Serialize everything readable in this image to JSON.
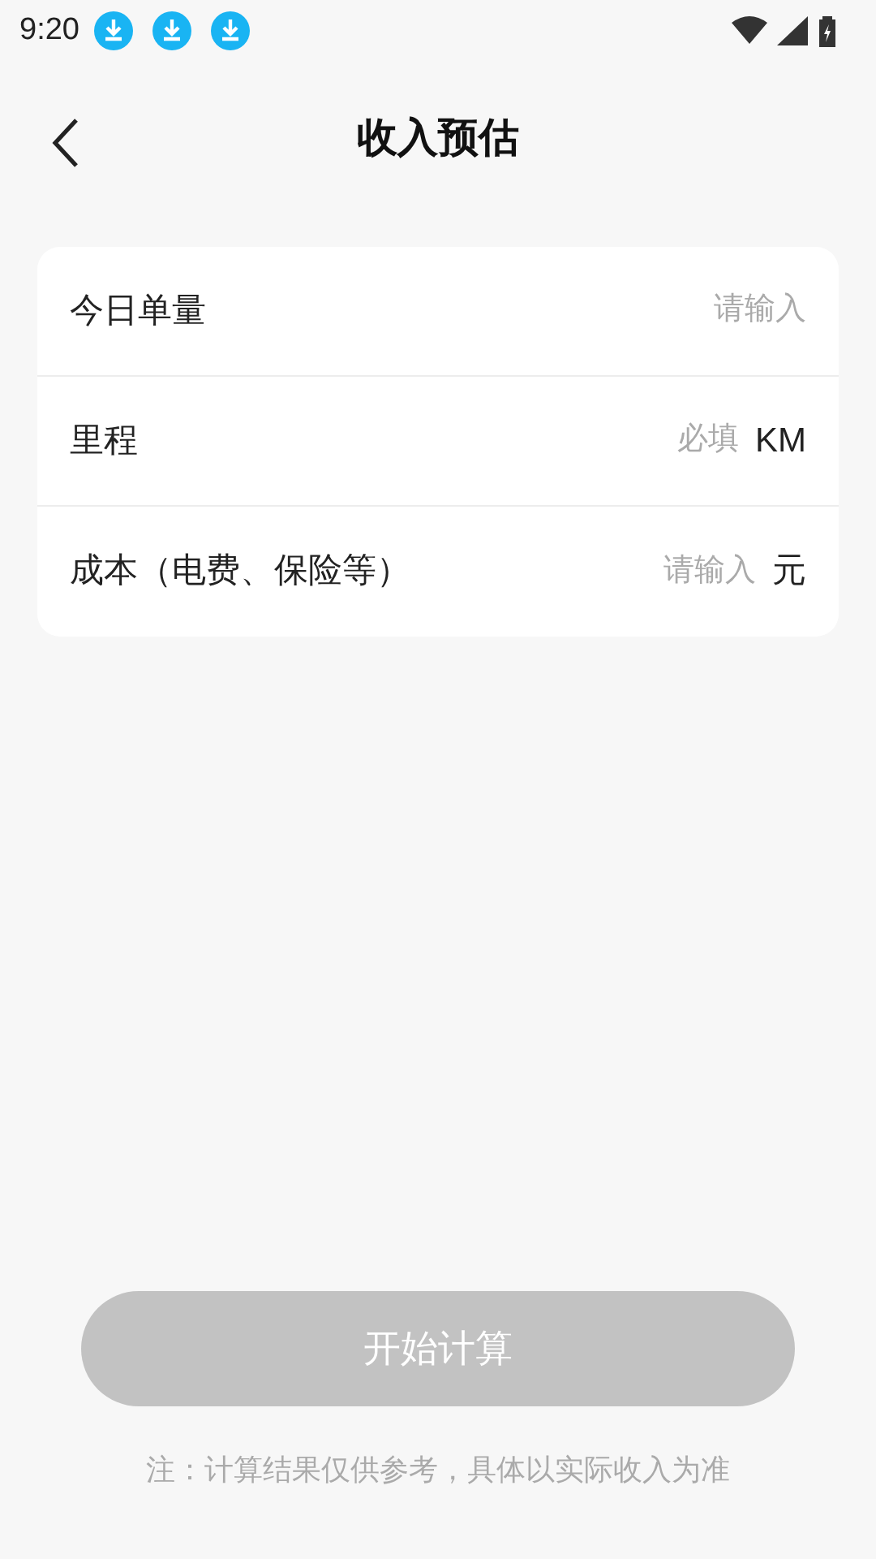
{
  "status_bar": {
    "time": "9:20"
  },
  "header": {
    "title": "收入预估"
  },
  "fields": [
    {
      "label": "今日单量",
      "placeholder": "请输入"
    },
    {
      "label": "里程",
      "placeholder": "必填",
      "unit": "KM"
    },
    {
      "label": "成本（电费、保险等）",
      "placeholder": "请输入",
      "unit": "元"
    }
  ],
  "button": {
    "label": "开始计算",
    "disabled": true
  },
  "note": "注：计算结果仅供参考，具体以实际收入为准"
}
